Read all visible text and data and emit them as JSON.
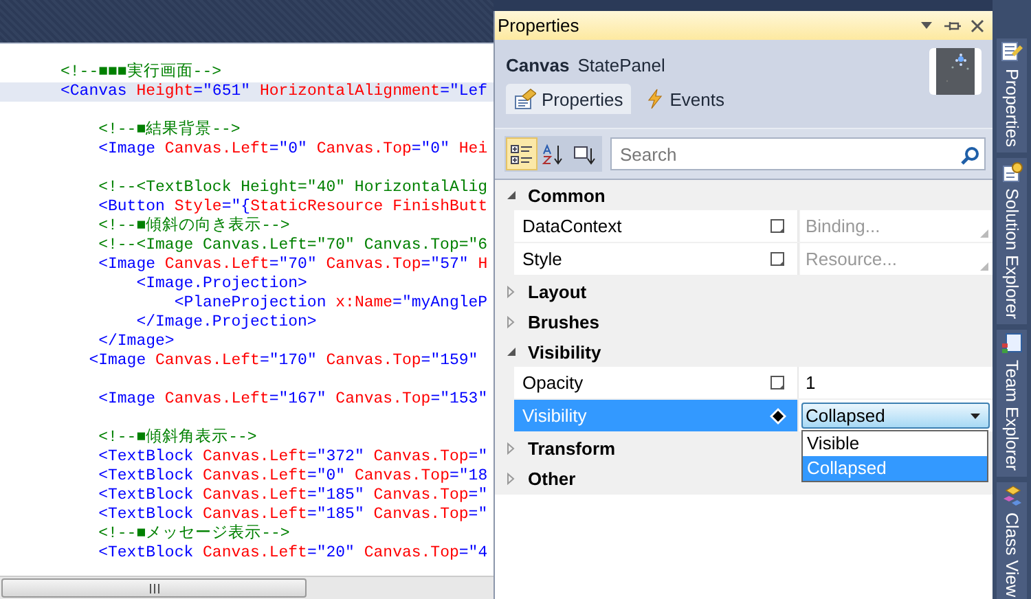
{
  "editor": {
    "lines": [
      {
        "current": false,
        "segments": [
          {
            "kind": "comment",
            "text": "<!--■■■実行画面-->"
          }
        ]
      },
      {
        "current": true,
        "segments": [
          {
            "kind": "tag",
            "text": "<Canvas"
          },
          {
            "kind": "attr",
            "text": " Height"
          },
          {
            "kind": "value",
            "text": "=\"651\""
          },
          {
            "kind": "attr",
            "text": " HorizontalAlignment"
          },
          {
            "kind": "value",
            "text": "=\"Lef"
          }
        ]
      },
      {
        "current": false
      },
      {
        "current": false,
        "segments": [
          {
            "kind": "comment",
            "text": "    <!--■結果背景-->"
          }
        ]
      },
      {
        "current": false,
        "segments": [
          {
            "kind": "tag",
            "text": "    <Image"
          },
          {
            "kind": "attr",
            "text": " Canvas.Left"
          },
          {
            "kind": "value",
            "text": "=\"0\""
          },
          {
            "kind": "attr",
            "text": " Canvas.Top"
          },
          {
            "kind": "value",
            "text": "=\"0\""
          },
          {
            "kind": "attr",
            "text": " Hei"
          }
        ]
      },
      {
        "current": false
      },
      {
        "current": false,
        "segments": [
          {
            "kind": "comment",
            "text": "    <!--<TextBlock Height=\"40\" HorizontalAlig"
          }
        ]
      },
      {
        "current": false,
        "segments": [
          {
            "kind": "tag",
            "text": "    <Button"
          },
          {
            "kind": "attr",
            "text": " Style"
          },
          {
            "kind": "value",
            "text": "=\"{"
          },
          {
            "kind": "attr",
            "text": "StaticResource FinishButt"
          }
        ]
      },
      {
        "current": false,
        "segments": [
          {
            "kind": "comment",
            "text": "    <!--■傾斜の向き表示-->"
          }
        ]
      },
      {
        "current": false,
        "segments": [
          {
            "kind": "comment",
            "text": "    <!--<Image Canvas.Left=\"70\" Canvas.Top=\"6"
          }
        ]
      },
      {
        "current": false,
        "segments": [
          {
            "kind": "tag",
            "text": "    <Image"
          },
          {
            "kind": "attr",
            "text": " Canvas.Left"
          },
          {
            "kind": "value",
            "text": "=\"70\""
          },
          {
            "kind": "attr",
            "text": " Canvas.Top"
          },
          {
            "kind": "value",
            "text": "=\"57\""
          },
          {
            "kind": "attr",
            "text": " H"
          }
        ]
      },
      {
        "current": false,
        "segments": [
          {
            "kind": "tag",
            "text": "        <Image.Projection>"
          }
        ]
      },
      {
        "current": false,
        "segments": [
          {
            "kind": "tag",
            "text": "            <PlaneProjection"
          },
          {
            "kind": "attr",
            "text": " x:Name"
          },
          {
            "kind": "value",
            "text": "=\"myAngleP"
          }
        ]
      },
      {
        "current": false,
        "segments": [
          {
            "kind": "tag",
            "text": "        </Image.Projection>"
          }
        ]
      },
      {
        "current": false,
        "segments": [
          {
            "kind": "tag",
            "text": "    </Image>"
          }
        ]
      },
      {
        "current": false,
        "segments": [
          {
            "kind": "tag",
            "text": "   <Image"
          },
          {
            "kind": "attr",
            "text": " Canvas.Left"
          },
          {
            "kind": "value",
            "text": "=\"170\""
          },
          {
            "kind": "attr",
            "text": " Canvas.Top"
          },
          {
            "kind": "value",
            "text": "=\"159\""
          }
        ]
      },
      {
        "current": false
      },
      {
        "current": false,
        "segments": [
          {
            "kind": "tag",
            "text": "    <Image"
          },
          {
            "kind": "attr",
            "text": " Canvas.Left"
          },
          {
            "kind": "value",
            "text": "=\"167\""
          },
          {
            "kind": "attr",
            "text": " Canvas.Top"
          },
          {
            "kind": "value",
            "text": "=\"153\""
          }
        ]
      },
      {
        "current": false
      },
      {
        "current": false,
        "segments": [
          {
            "kind": "comment",
            "text": "    <!--■傾斜角表示-->"
          }
        ]
      },
      {
        "current": false,
        "segments": [
          {
            "kind": "tag",
            "text": "    <TextBlock"
          },
          {
            "kind": "attr",
            "text": " Canvas.Left"
          },
          {
            "kind": "value",
            "text": "=\"372\""
          },
          {
            "kind": "attr",
            "text": " Canvas.Top"
          },
          {
            "kind": "value",
            "text": "=\""
          }
        ]
      },
      {
        "current": false,
        "segments": [
          {
            "kind": "tag",
            "text": "    <TextBlock"
          },
          {
            "kind": "attr",
            "text": " Canvas.Left"
          },
          {
            "kind": "value",
            "text": "=\"0\""
          },
          {
            "kind": "attr",
            "text": " Canvas.Top"
          },
          {
            "kind": "value",
            "text": "=\"18"
          }
        ]
      },
      {
        "current": false,
        "segments": [
          {
            "kind": "tag",
            "text": "    <TextBlock"
          },
          {
            "kind": "attr",
            "text": " Canvas.Left"
          },
          {
            "kind": "value",
            "text": "=\"185\""
          },
          {
            "kind": "attr",
            "text": " Canvas.Top"
          },
          {
            "kind": "value",
            "text": "=\""
          }
        ]
      },
      {
        "current": false,
        "segments": [
          {
            "kind": "tag",
            "text": "    <TextBlock"
          },
          {
            "kind": "attr",
            "text": " Canvas.Left"
          },
          {
            "kind": "value",
            "text": "=\"185\""
          },
          {
            "kind": "attr",
            "text": " Canvas.Top"
          },
          {
            "kind": "value",
            "text": "=\""
          }
        ]
      },
      {
        "current": false,
        "segments": [
          {
            "kind": "comment",
            "text": "    <!--■メッセージ表示-->"
          }
        ]
      },
      {
        "current": false,
        "segments": [
          {
            "kind": "tag",
            "text": "    <TextBlock"
          },
          {
            "kind": "attr",
            "text": " Canvas.Left"
          },
          {
            "kind": "value",
            "text": "=\"20\""
          },
          {
            "kind": "attr",
            "text": " Canvas.Top"
          },
          {
            "kind": "value",
            "text": "=\"4"
          }
        ]
      }
    ]
  },
  "properties_panel": {
    "title": "Properties",
    "object_type": "Canvas",
    "object_name": "StatePanel",
    "tabs": [
      {
        "label": "Properties",
        "selected": true
      },
      {
        "label": "Events",
        "selected": false
      }
    ],
    "view_buttons": [
      {
        "kind": "categorized",
        "selected": true
      },
      {
        "kind": "alphabetical",
        "selected": false
      },
      {
        "kind": "filter",
        "selected": false
      }
    ],
    "search": {
      "placeholder": "Search"
    },
    "categories": [
      {
        "name": "Common",
        "expanded": true,
        "properties": [
          {
            "name": "DataContext",
            "value_set": false,
            "kind": "hint",
            "placeholder": "Binding...",
            "selected": false
          },
          {
            "name": "Style",
            "value_set": false,
            "kind": "hint",
            "placeholder": "Resource...",
            "selected": false
          }
        ]
      },
      {
        "name": "Layout",
        "expanded": false
      },
      {
        "name": "Brushes",
        "expanded": false
      },
      {
        "name": "Visibility",
        "expanded": true,
        "properties": [
          {
            "name": "Opacity",
            "value_set": false,
            "kind": "text",
            "value": "1",
            "selected": false
          },
          {
            "name": "Visibility",
            "value_set": true,
            "kind": "combo",
            "value": "Collapsed",
            "selected": true,
            "open": true,
            "options": [
              {
                "label": "Visible",
                "selected": false
              },
              {
                "label": "Collapsed",
                "selected": true
              }
            ]
          }
        ]
      },
      {
        "name": "Transform",
        "expanded": false
      },
      {
        "name": "Other",
        "expanded": false
      }
    ]
  },
  "dock_tabs": [
    {
      "label": "Properties",
      "kind": "properties"
    },
    {
      "label": "Solution Explorer",
      "kind": "solution"
    },
    {
      "label": "Team Explorer",
      "kind": "team"
    },
    {
      "label": "Class View",
      "kind": "classview"
    }
  ]
}
